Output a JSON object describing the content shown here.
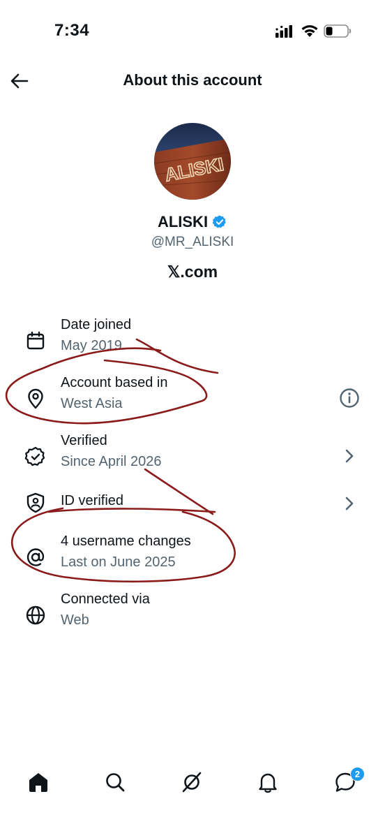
{
  "status": {
    "time": "7:34"
  },
  "header": {
    "title": "About this account"
  },
  "profile": {
    "display_name": "ALISKI",
    "handle": "@MR_ALISKI",
    "source": "𝕏.com",
    "avatar_text": "ALISKI"
  },
  "rows": [
    {
      "label": "Date joined",
      "value": "May 2019",
      "icon": "calendar-icon"
    },
    {
      "label": "Account based in",
      "value": "West Asia",
      "icon": "location-pin-icon",
      "trailing": "info-icon"
    },
    {
      "label": "Verified",
      "value": "Since April 2026",
      "icon": "verified-badge-icon",
      "trailing": "chevron-right-icon"
    },
    {
      "label": "ID verified",
      "value": "",
      "icon": "shield-person-icon",
      "trailing": "chevron-right-icon"
    },
    {
      "label": "4 username changes",
      "value": "Last on June 2025",
      "icon": "at-sign-icon"
    },
    {
      "label": "Connected via",
      "value": "Web",
      "icon": "globe-icon"
    }
  ],
  "tabs": [
    {
      "name": "home",
      "icon": "home-icon"
    },
    {
      "name": "search",
      "icon": "search-icon"
    },
    {
      "name": "grok",
      "icon": "grok-icon"
    },
    {
      "name": "notifications",
      "icon": "bell-icon"
    },
    {
      "name": "messages",
      "icon": "messages-icon"
    }
  ],
  "badges": {
    "messages_count": "2"
  },
  "colors": {
    "accent": "#1d9bf0",
    "secondary_text": "#536471",
    "annotation_ink": "#8b1a1a"
  }
}
